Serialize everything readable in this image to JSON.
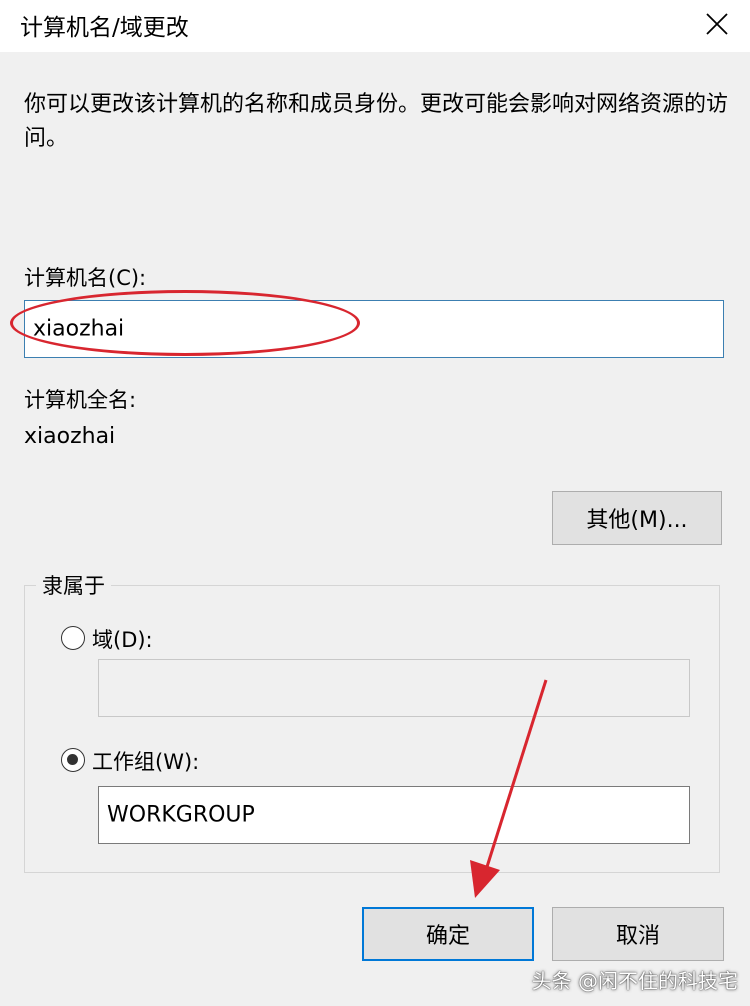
{
  "window": {
    "title": "计算机名/域更改"
  },
  "description": "你可以更改该计算机的名称和成员身份。更改可能会影响对网络资源的访问。",
  "computer_name": {
    "label": "计算机名(C):",
    "value": "xiaozhai"
  },
  "full_name": {
    "label": "计算机全名:",
    "value": "xiaozhai"
  },
  "buttons": {
    "more": "其他(M)...",
    "ok": "确定",
    "cancel": "取消"
  },
  "member_of": {
    "label": "隶属于",
    "domain": {
      "label": "域(D):",
      "value": "",
      "selected": false
    },
    "workgroup": {
      "label": "工作组(W):",
      "value": "WORKGROUP",
      "selected": true
    }
  },
  "watermark": "头条 @闲不住的科技宅",
  "colors": {
    "annotation": "#d8262f",
    "focus_border": "#0078d7",
    "textbox_focus": "#3c7fb1"
  }
}
